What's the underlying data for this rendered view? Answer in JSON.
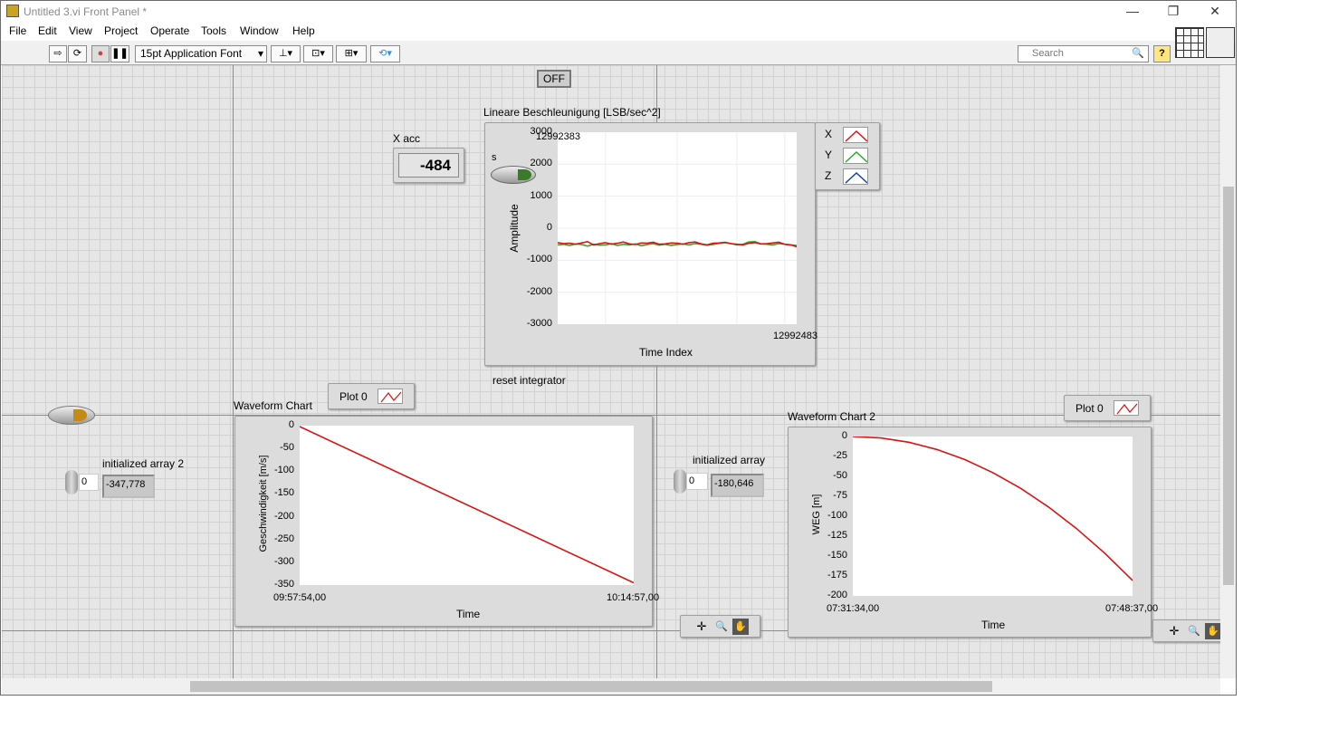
{
  "window": {
    "title": "Untitled 3.vi Front Panel *",
    "minimize": "—",
    "restore": "❐",
    "close": "✕"
  },
  "menu": [
    "File",
    "Edit",
    "View",
    "Project",
    "Operate",
    "Tools",
    "Window",
    "Help"
  ],
  "toolbar": {
    "run": "⇨",
    "run_continuous": "⟳",
    "abort": "●",
    "pause": "❚❚",
    "font": "15pt Application Font",
    "font_arrow": "▾",
    "align": "⊥▾",
    "distribute": "⊡▾",
    "resize": "⊞▾",
    "reorder": "⟲▾",
    "search_placeholder": "Search",
    "search_icon": "🔍",
    "help": "?"
  },
  "controls": {
    "off_button": "OFF",
    "x_acc": {
      "label": "X acc",
      "value": "-484"
    },
    "switch_label": "s",
    "reset_label": "reset integrator",
    "array2": {
      "label": "initialized array 2",
      "index": "0",
      "value": "-347,778"
    },
    "array1": {
      "label": "initialized array",
      "index": "0",
      "value": "-180,646"
    }
  },
  "charts": {
    "accel": {
      "title": "Lineare Beschleunigung [LSB/sec^2]",
      "ylabel": "Amplitude",
      "xlabel": "Time Index",
      "yticks": [
        "3000",
        "2000",
        "1000",
        "0",
        "-1000",
        "-2000",
        "-3000"
      ],
      "ylim": [
        -3000,
        3000
      ],
      "xticks": [
        "12992383",
        "12992483"
      ],
      "xlim": [
        12992383,
        12992483
      ],
      "legend": [
        {
          "name": "X",
          "color": "#e01010"
        },
        {
          "name": "Y",
          "color": "#2ea82e"
        },
        {
          "name": "Z",
          "color": "#1040c0"
        }
      ],
      "series": [
        {
          "name": "X",
          "color": "#e01010",
          "values": [
            -450,
            -480,
            -470,
            -500,
            -460,
            -420,
            -520,
            -480,
            -450,
            -500,
            -470,
            -430,
            -490,
            -510,
            -460,
            -470,
            -440,
            -500,
            -490,
            -460,
            -470,
            -500,
            -450,
            -430,
            -490,
            -520,
            -470,
            -460,
            -440,
            -480,
            -500,
            -520,
            -470,
            -450,
            -490,
            -480,
            -460,
            -440,
            -500,
            -520,
            -580
          ]
        },
        {
          "name": "Y",
          "color": "#2ea82e",
          "values": [
            -520,
            -500,
            -540,
            -490,
            -510,
            -560,
            -500,
            -530,
            -520,
            -480,
            -540,
            -500,
            -520,
            -490,
            -550,
            -510,
            -480,
            -530,
            -500,
            -540,
            -510,
            -490,
            -520,
            -480,
            -500,
            -530,
            -510,
            -470,
            -450,
            -480,
            -520,
            -500,
            -430,
            -420,
            -490,
            -500,
            -520,
            -480,
            -500,
            -520,
            -540
          ]
        }
      ]
    },
    "velocity": {
      "title": "Waveform Chart",
      "legend": "Plot 0",
      "ylabel": "Geschwindigkeit [m/s]",
      "xlabel": "Time",
      "yticks": [
        "0",
        "-50",
        "-100",
        "-150",
        "-200",
        "-250",
        "-300",
        "-350"
      ],
      "ylim": [
        -350,
        0
      ],
      "xticks": [
        "09:57:54,00",
        "10:14:57,00"
      ],
      "series": [
        {
          "name": "Plot 0",
          "color": "#e01010",
          "values": [
            -2,
            -345
          ]
        }
      ]
    },
    "distance": {
      "title": "Waveform Chart 2",
      "legend": "Plot 0",
      "ylabel": "WEG [m]",
      "xlabel": "Time",
      "yticks": [
        "0",
        "-25",
        "-50",
        "-75",
        "-100",
        "-125",
        "-150",
        "-175",
        "-200"
      ],
      "ylim": [
        -200,
        0
      ],
      "xticks": [
        "07:31:34,00",
        "07:48:37,00"
      ],
      "series": [
        {
          "name": "Plot 0",
          "color": "#e01010",
          "values": [
            0,
            -1.8,
            -7.2,
            -16.3,
            -28.9,
            -45.2,
            -65.0,
            -88.5,
            -115.6,
            -146.3,
            -180.6
          ]
        }
      ]
    }
  },
  "palette": {
    "cursor": "✛",
    "zoom": "🔍",
    "pan": "✋"
  }
}
